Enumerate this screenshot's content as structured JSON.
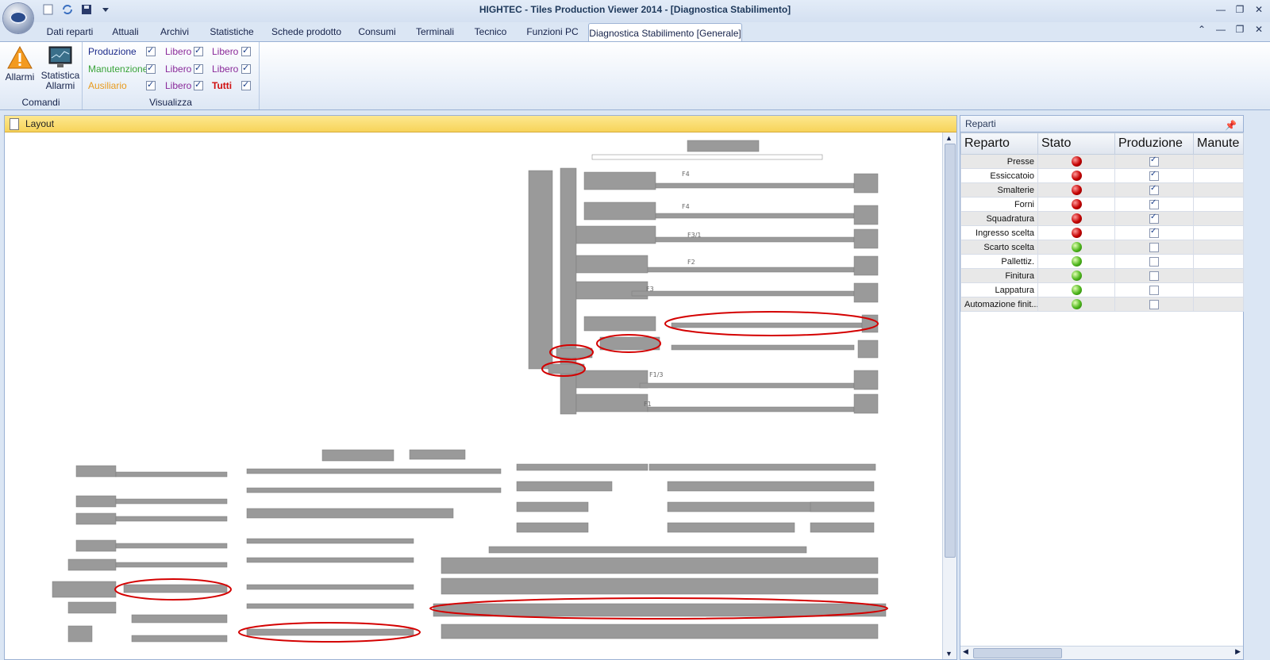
{
  "window": {
    "title": "HIGHTEC - Tiles Production Viewer 2014 - [Diagnostica Stabilimento]"
  },
  "tabs": [
    {
      "label": "Dati reparti"
    },
    {
      "label": "Attuali"
    },
    {
      "label": "Archivi"
    },
    {
      "label": "Statistiche"
    },
    {
      "label": "Schede prodotto"
    },
    {
      "label": "Consumi"
    },
    {
      "label": "Terminali"
    },
    {
      "label": "Tecnico"
    },
    {
      "label": "Funzioni PC"
    },
    {
      "label": "Diagnostica Stabilimento  [Generale]"
    }
  ],
  "ribbon": {
    "comandi": {
      "group_label": "Comandi",
      "allarmi": "Allarmi",
      "statistica_l1": "Statistica",
      "statistica_l2": "Allarmi"
    },
    "visualizza": {
      "group_label": "Visualizza",
      "items": [
        {
          "label": "Produzione",
          "checked": true,
          "color": "#1b2a8a"
        },
        {
          "label": "Manutenzione",
          "checked": true,
          "color": "#3aa43a"
        },
        {
          "label": "Ausiliario",
          "checked": true,
          "color": "#e89a1c"
        },
        {
          "label": "Libero",
          "checked": true,
          "color": "#8a2a9a"
        },
        {
          "label": "Libero",
          "checked": true,
          "color": "#8a2a9a"
        },
        {
          "label": "Libero",
          "checked": true,
          "color": "#8a2a9a"
        },
        {
          "label": "Libero",
          "checked": true,
          "color": "#8a2a9a"
        },
        {
          "label": "Libero",
          "checked": true,
          "color": "#8a2a9a"
        },
        {
          "label": "Tutti",
          "checked": true,
          "color": "#d01010"
        }
      ]
    }
  },
  "layout_panel": {
    "title": "Layout",
    "plant_labels": [
      "F4",
      "F4",
      "F3/1",
      "F2",
      "F3",
      "F1/3",
      "F1"
    ]
  },
  "reparti_panel": {
    "title": "Reparti",
    "columns": [
      "Reparto",
      "Stato",
      "Produzione",
      "Manute"
    ],
    "rows": [
      {
        "name": "Presse",
        "stato": "red",
        "produzione": true
      },
      {
        "name": "Essiccatoio",
        "stato": "red",
        "produzione": true
      },
      {
        "name": "Smalterie",
        "stato": "red",
        "produzione": true
      },
      {
        "name": "Forni",
        "stato": "red",
        "produzione": true
      },
      {
        "name": "Squadratura",
        "stato": "red",
        "produzione": true
      },
      {
        "name": "Ingresso scelta",
        "stato": "red",
        "produzione": true
      },
      {
        "name": "Scarto scelta",
        "stato": "green",
        "produzione": false
      },
      {
        "name": "Pallettiz.",
        "stato": "green",
        "produzione": false
      },
      {
        "name": "Finitura",
        "stato": "green",
        "produzione": false
      },
      {
        "name": "Lappatura",
        "stato": "green",
        "produzione": false
      },
      {
        "name": "Automazione finit...",
        "stato": "green",
        "produzione": false
      }
    ]
  }
}
